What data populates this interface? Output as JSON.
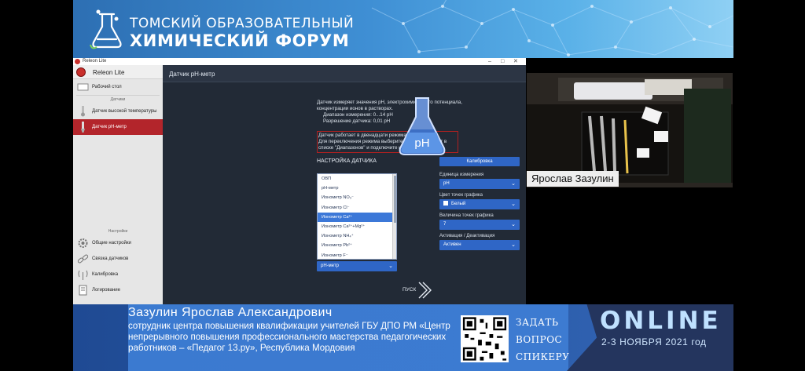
{
  "banner": {
    "line1": "ТОМСКИЙ ОБРАЗОВАТЕЛЬНЫЙ",
    "line2": "ХИМИЧЕСКИЙ ФОРУМ"
  },
  "app": {
    "window_title": "Releon Lite",
    "brand": "Releon Lite",
    "sidebar": {
      "items_top": [
        {
          "label": "Рабочий стол",
          "icon": "desktop-icon"
        }
      ],
      "section_sensors": "Датчики",
      "sensors": [
        {
          "label": "Датчик высокой температуры",
          "icon": "thermometer-icon",
          "active": false
        },
        {
          "label": "Датчик pH-метр",
          "icon": "ph-probe-icon",
          "active": true
        }
      ],
      "section_settings": "Настройки",
      "settings": [
        {
          "label": "Общие настройки",
          "icon": "gear-icon"
        },
        {
          "label": "Связка датчиков",
          "icon": "link-icon"
        },
        {
          "label": "Калибровка",
          "icon": "antenna-icon"
        },
        {
          "label": "Логирование",
          "icon": "log-icon"
        }
      ]
    },
    "page_title": "Датчик pH-метр",
    "description": {
      "line1": "Датчик измеряет значения pH, электрохимического потенциала,",
      "line2": "концентрации ионов в растворах.",
      "range": "Диапазон измерения: 0...14 pH",
      "resolution": "Разрешение датчика: 0,01 pH",
      "modes1": "Датчик работает в двенадцати режимах.",
      "modes2": "Для переключения режима выберите требуемый пункт в",
      "modes3": "списке \"Диапазонов\" и подключите необходимый щуп."
    },
    "flask_label": "pH",
    "settings_title": "НАСТРОЙКА ДАТЧИКА",
    "calibrate_button": "Калибровка",
    "range_dropdown": {
      "options": [
        "ОВП",
        "pH-метр",
        "Ионометр NO₃⁻",
        "Ионометр Cl⁻",
        "Ионометр Ca²⁺",
        "Ионометр Ca²⁺+Mg²⁺",
        "Ионометр NH₄⁺",
        "Ионометр Pb²⁺",
        "Ионометр F⁻"
      ],
      "highlighted_index": 4,
      "selected": "pH-метр"
    },
    "unit": {
      "label": "Единица измерения",
      "value": "pH"
    },
    "point_color": {
      "label": "Цвет точек графика",
      "value": "Белый"
    },
    "point_size": {
      "label": "Величина точек графика",
      "value": "7"
    },
    "activation": {
      "label": "Активация / Деактивация",
      "value": "Активен"
    },
    "start_label": "ПУСК"
  },
  "webcam": {
    "speaker_tag": "Ярослав Зазулин"
  },
  "lower_third": {
    "speaker_name": "Зазулин Ярослав Александрович",
    "info_line1": "сотрудник центра повышения квалификации учителей ГБУ ДПО РМ «Центр",
    "info_line2": "непрерывного повышения профессионального мастерства педагогических",
    "info_line3": "работников – «Педагог 13.ру», Республика Мордовия",
    "ask1": "ЗАДАТЬ",
    "ask2": "ВОПРОС",
    "ask3": "СПИКЕРУ",
    "online": "ONLINE",
    "dates": "2-3 НОЯБРЯ 2021 год"
  },
  "colors": {
    "accent_red": "#b3252b",
    "button_blue": "#2f66c6",
    "panel_dark": "#222a36",
    "banner_blue": "#3f8fd4"
  }
}
